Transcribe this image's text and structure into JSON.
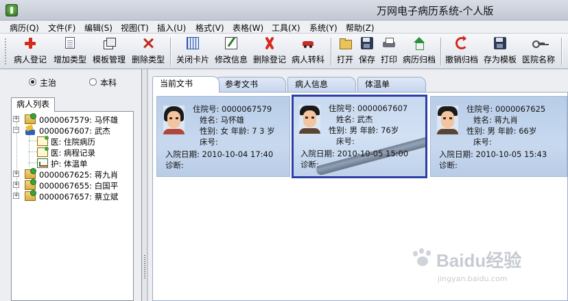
{
  "window": {
    "title": "万网电子病历系统-个人版"
  },
  "menu": [
    {
      "label": "病历(Q)"
    },
    {
      "label": "文件(F)"
    },
    {
      "label": "编辑(S)"
    },
    {
      "label": "视图(T)"
    },
    {
      "label": "插入(U)"
    },
    {
      "label": "格式(V)"
    },
    {
      "label": "表格(W)"
    },
    {
      "label": "工具(X)"
    },
    {
      "label": "系统(Y)"
    },
    {
      "label": "帮助(Z)"
    }
  ],
  "toolbar": [
    {
      "label": "病人登记",
      "icon": "plus-icon"
    },
    {
      "label": "增加类型",
      "icon": "document-icon"
    },
    {
      "label": "模板管理",
      "icon": "template-icon"
    },
    {
      "label": "删除类型",
      "icon": "delete-icon"
    },
    {
      "label": "关闭卡片",
      "icon": "grid-icon"
    },
    {
      "label": "修改信息",
      "icon": "edit-icon"
    },
    {
      "label": "删除登记",
      "icon": "delete-red-icon"
    },
    {
      "label": "病人转科",
      "icon": "ambulance-icon"
    },
    {
      "label": "打开",
      "icon": "folder-open-icon"
    },
    {
      "label": "保存",
      "icon": "floppy-disk-icon"
    },
    {
      "label": "打印",
      "icon": "printer-icon"
    },
    {
      "label": "病历归档",
      "icon": "archive-house-icon"
    },
    {
      "label": "撤销归档",
      "icon": "undo-icon"
    },
    {
      "label": "存为模板",
      "icon": "save-template-icon"
    },
    {
      "label": "医院名称",
      "icon": "key-icon"
    }
  ],
  "left_panel": {
    "radio_options": [
      {
        "label": "主治",
        "selected": true
      },
      {
        "label": "本科",
        "selected": false
      }
    ],
    "tab_label": "病人列表",
    "tree": [
      {
        "label": "0000067579: 马怀雄",
        "expander": "+"
      },
      {
        "label": "0000067607: 武杰",
        "expander": "−"
      },
      {
        "label": "医: 住院病历"
      },
      {
        "label": "医: 病程记录"
      },
      {
        "label": "护: 体温单"
      },
      {
        "label": "0000067625: 蒋九肖",
        "expander": "+"
      },
      {
        "label": "0000067655: 白国平",
        "expander": "+"
      },
      {
        "label": "0000067657: 蔡立斌",
        "expander": "+"
      }
    ]
  },
  "tabs": [
    {
      "label": "当前文书",
      "active": true
    },
    {
      "label": "参考文书",
      "active": false
    },
    {
      "label": "病人信息",
      "active": false
    },
    {
      "label": "体温单",
      "active": false
    }
  ],
  "cards": [
    {
      "id_label": "住院号: 0000067579",
      "name_label": "姓名: 马怀雄",
      "sex_age_label": "性别: 女  年龄: 7 3 岁",
      "bed_label": "床号:",
      "admit_label": "入院日期:   2010-10-04 17:40",
      "diag_label": "诊断:",
      "avatar": "female"
    },
    {
      "id_label": "住院号: 0000067607",
      "name_label": "姓名: 武杰",
      "sex_age_label": "性别: 男  年龄: 76岁",
      "bed_label": "床号:",
      "admit_label": "入院日期:   2010-10-05 15:00",
      "diag_label": "诊断:",
      "avatar": "male",
      "selected": true
    },
    {
      "id_label": "住院号: 0000067625",
      "name_label": "姓名: 蒋九肖",
      "sex_age_label": "性别: 男  年龄: 66岁",
      "bed_label": "床号:",
      "admit_label": "入院日期:   2010-10-05 15:43",
      "diag_label": "诊断:",
      "avatar": "male"
    }
  ],
  "watermark": {
    "main": "Baidu经验",
    "sub": "jingyan.baidu.com"
  }
}
